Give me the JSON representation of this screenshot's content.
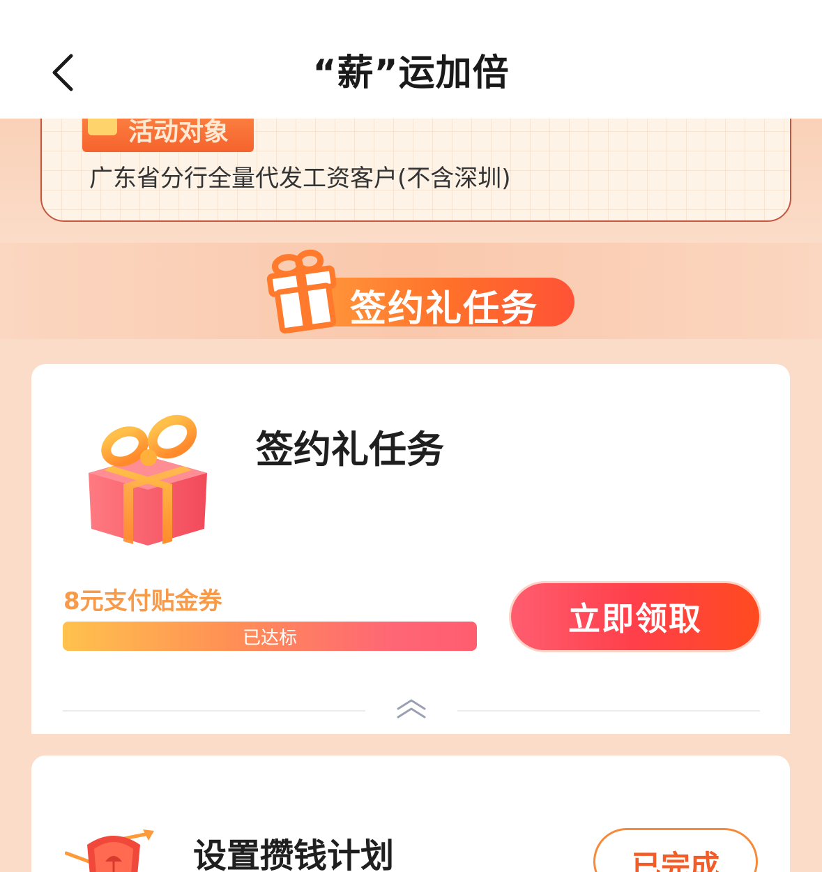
{
  "header": {
    "title": "“薪”运加倍",
    "back_icon": "chevron-left-icon"
  },
  "audience": {
    "tag_label": "活动对象",
    "text": "广东省分行全量代发工资客户(不含深圳)"
  },
  "section": {
    "banner_title": "签约礼任务",
    "banner_icon": "gift-box-icon"
  },
  "task1": {
    "title": "签约礼任务",
    "reward": "8元支付贴金券",
    "progress_text": "已达标",
    "progress_fraction": 1.0,
    "claim_label": "立即领取",
    "collapse_icon": "double-chevron-up-icon"
  },
  "task2": {
    "title": "设置攒钱计划",
    "status_label": "已完成",
    "icon": "shield-icon"
  },
  "colors": {
    "accent_orange": "#ff6f2a",
    "claim_red": "#ff3f4a",
    "reward_orange": "#f79a4a",
    "page_bg": "#fbdcc8"
  }
}
